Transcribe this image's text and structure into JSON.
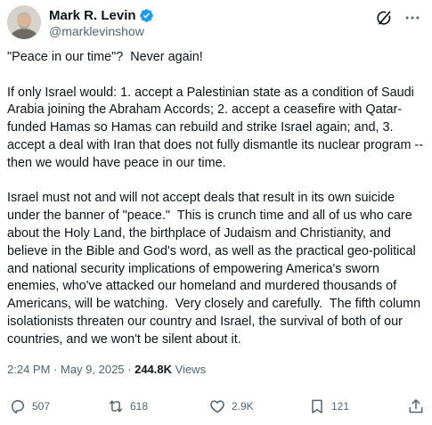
{
  "author": {
    "display_name": "Mark R. Levin",
    "handle": "@marklevinshow",
    "verified": true
  },
  "header_icons": [
    "grok-icon",
    "more-options-icon"
  ],
  "tweet": {
    "paragraph_1": "\"Peace in our time\"?  Never again!",
    "paragraph_2": "If only Israel would: 1. accept a Palestinian state as a condition of Saudi Arabia joining the Abraham Accords; 2. accept a ceasefire with Qatar-funded Hamas so Hamas can rebuild and strike Israel again; and, 3. accept a deal with Iran that does not fully dismantle its nuclear program -- then we would have peace in our time.",
    "paragraph_3": "Israel must not and will not accept deals that result in its own suicide under the banner of \"peace.\"  This is crunch time and all of us who care about the Holy Land, the birthplace of Judaism and Christianity, and believe in the Bible and God's word, as well as the practical geo-political and national security implications of empowering America's sworn enemies, who've attacked our homeland and murdered thousands of Americans, will be watching.  Very closely and carefully.  The fifth column isolationists threaten our country and Israel, the survival of both of our countries, and we won't be silent about it."
  },
  "meta": {
    "time": "2:24 PM",
    "separator": " · ",
    "date": "May 9, 2025",
    "views_count": "244.8K",
    "views_label": " Views"
  },
  "actions": {
    "reply_count": "507",
    "repost_count": "618",
    "like_count": "2.9K",
    "bookmark_count": "121"
  },
  "colors": {
    "text": "#0f1419",
    "secondary": "#536471",
    "verified_blue": "#1d9bf0"
  }
}
